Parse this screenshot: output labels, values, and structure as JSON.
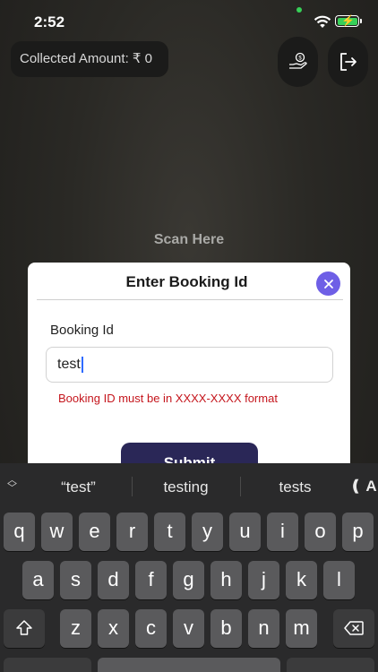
{
  "status_bar": {
    "time": "2:52"
  },
  "header": {
    "collected_amount": "Collected Amount: ₹ 0"
  },
  "scan": {
    "label": "Scan Here"
  },
  "modal": {
    "title": "Enter Booking Id",
    "field_label": "Booking Id",
    "input_value": "test",
    "error": "Booking ID must be in XXXX-XXXX format",
    "submit_label": "Submit",
    "accent_color": "#6e5fe6"
  },
  "keyboard": {
    "suggestions": [
      "“test”",
      "testing",
      "tests"
    ],
    "suggest_end": "❪ A",
    "row1": [
      "q",
      "w",
      "e",
      "r",
      "t",
      "y",
      "u",
      "i",
      "o",
      "p"
    ],
    "row2": [
      "a",
      "s",
      "d",
      "f",
      "g",
      "h",
      "j",
      "k",
      "l"
    ],
    "row3": [
      "z",
      "x",
      "c",
      "v",
      "b",
      "n",
      "m"
    ]
  }
}
